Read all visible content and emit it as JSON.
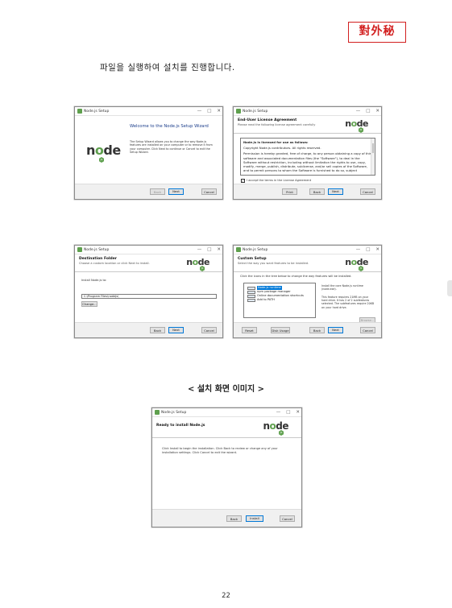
{
  "stamp": "對外秘",
  "instruction": "파일을 실행하여 설치를 진행합니다.",
  "caption": "< 설치 화면 이미지 >",
  "page_number": "22",
  "win_common": {
    "title": "Node.js Setup",
    "minimize": "—",
    "maximize": "□",
    "close": "✕",
    "logo_text_a": "n",
    "logo_text_o": "o",
    "logo_text_b": "de",
    "logo_badge": "JS"
  },
  "win1": {
    "heading": "Welcome to the Node.js Setup Wizard",
    "body": "The Setup Wizard allows you to change the way Node.js features are installed on your computer or to remove it from your computer. Click Next to continue or Cancel to exit the Setup Wizard.",
    "back": "Back",
    "next": "Next",
    "cancel": "Cancel"
  },
  "win2": {
    "header_title": "End-User License Agreement",
    "header_sub": "Please read the following license agreement carefully",
    "license_heading": "Node.js is licensed for use as follows:",
    "license_p1": "Copyright Node.js contributors. All rights reserved.",
    "license_p2": "Permission is hereby granted, free of charge, to any person obtaining a copy of this software and associated documentation files (the \"Software\"), to deal in the Software without restriction, including without limitation the rights to use, copy, modify, merge, publish, distribute, sublicense, and/or sell copies of the Software, and to permit persons to whom the Software is furnished to do so, subject",
    "accept": "I accept the terms in the License Agreement",
    "accept_checked": "✓",
    "print": "Print",
    "back": "Back",
    "next": "Next",
    "cancel": "Cancel"
  },
  "win3": {
    "header_title": "Destination Folder",
    "header_sub": "Choose a custom location or click Next to install.",
    "label": "Install Node.js to:",
    "path": "C:\\Program Files\\nodejs\\",
    "change": "Change...",
    "back": "Back",
    "next": "Next",
    "cancel": "Cancel"
  },
  "win4": {
    "header_title": "Custom Setup",
    "header_sub": "Select the way you want features to be installed.",
    "instruction": "Click the icons in the tree below to change the way features will be installed.",
    "tree": [
      "Node.js runtime",
      "npm package manager",
      "Online documentation shortcuts",
      "Add to PATH"
    ],
    "desc1": "Install the core Node.js runtime (node.exe).",
    "desc2": "This feature requires 21MB on your hard drive. It has 2 of 2 subfeatures selected. The subfeatures require 20KB on your hard drive.",
    "browse": "Browse...",
    "reset": "Reset",
    "disk_usage": "Disk Usage",
    "back": "Back",
    "next": "Next",
    "cancel": "Cancel"
  },
  "win5": {
    "header_title": "Ready to install Node.js",
    "body": "Click Install to begin the installation. Click Back to review or change any of your installation settings. Click Cancel to exit the wizard.",
    "back": "Back",
    "install": "Install",
    "cancel": "Cancel"
  }
}
